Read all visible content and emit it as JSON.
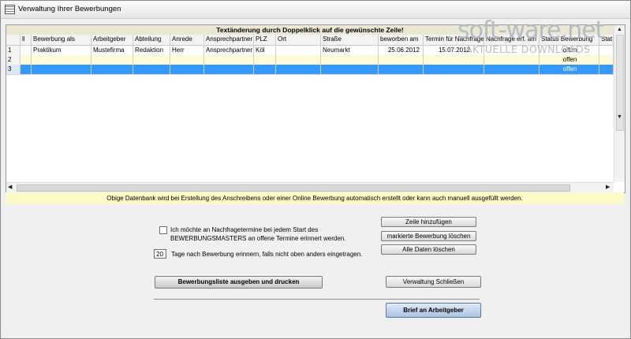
{
  "window": {
    "title": "Verwaltung Ihrer Bewerbungen"
  },
  "watermark": {
    "brand": "soft-ware.net",
    "tagline": "AKTUELLE DOWNLOADS"
  },
  "grid": {
    "header": "Textänderung durch Doppelklick auf die gewünschte Zeile!",
    "columns": [
      "ll",
      "Bewerbung als",
      "Arbeitgeber",
      "Abteilung",
      "Anrede",
      "Ansprechpartner",
      "PLZ",
      "Ort",
      "Straße",
      "beworben am",
      "Termin für Nachfrage",
      "Nachfrage erf. am",
      "Status Bewerbung",
      "Stat"
    ],
    "rows": [
      {
        "num": "1",
        "cells": [
          "",
          "Praktikum",
          "Mustefirma",
          "Redaktion",
          "Herr",
          "Ansprechpartner",
          "Köl",
          "",
          "Neumarkt",
          "25.06.2012",
          "15.07.2012",
          "",
          "offen",
          ""
        ]
      },
      {
        "num": "2",
        "cells": [
          "",
          "",
          "",
          "",
          "",
          "",
          "",
          "",
          "",
          "",
          "",
          "",
          "offen",
          ""
        ]
      },
      {
        "num": "3",
        "cells": [
          "",
          "",
          "",
          "",
          "",
          "",
          "",
          "",
          "",
          "",
          "",
          "",
          "offen",
          ""
        ]
      }
    ]
  },
  "info": {
    "text": "Obige Datenbank wird bei Erstellung des Anschreibens oder einer Online Bewerbung automatisch erstellt oder kann auch manuell ausgefüllt werden."
  },
  "options": {
    "reminder_line1": "Ich möchte an Nachfragetermine bei jedem Start des",
    "reminder_line2": "BEWERBUNGSMASTERS an offene Termine erinnert werden.",
    "reminder_checked": false,
    "days_value": "20",
    "days_label": "Tage nach Bewerbung erinnern, falls nicht oben anders eingetragen."
  },
  "buttons": {
    "add_row": "Zeile hinzufügen",
    "delete_marked": "markierte Bewerbung löschen",
    "delete_all": "Alle Daten löschen",
    "print_list": "Bewerbungsliste ausgeben und drucken",
    "close": "Verwaltung Schließen",
    "letter": "Brief an Arbeitgeber"
  }
}
